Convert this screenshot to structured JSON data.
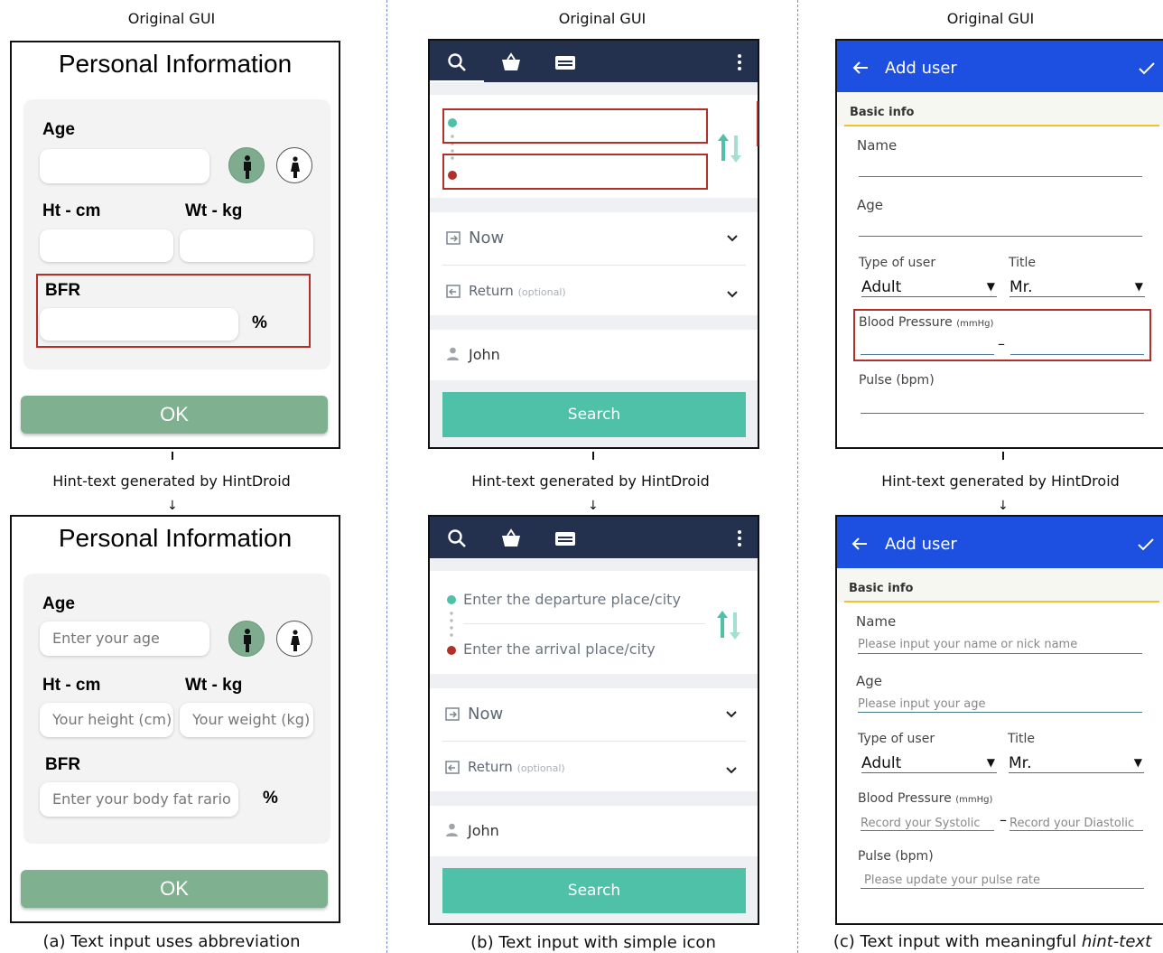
{
  "column_header": "Original GUI",
  "hint_label": "Hint-text generated by HintDroid",
  "captions": {
    "a": "(a) Text input uses abbreviation",
    "b": "(b) Text input with simple icon",
    "c_prefix": "(c) Text input with meaningful ",
    "c_italic": "hint-text"
  },
  "panel_a": {
    "title": "Personal Information",
    "age_label": "Age",
    "ht_label": "Ht - cm",
    "wt_label": "Wt - kg",
    "bfr_label": "BFR",
    "percent": "%",
    "ok": "OK",
    "hints": {
      "age": "Enter your age",
      "height": "Your height (cm)",
      "weight": "Your weight (kg)",
      "bfr": "Enter your body fat rario"
    }
  },
  "panel_b": {
    "date_label": "Now",
    "return_label": "Return",
    "return_optional": "(optional)",
    "passenger": "John",
    "search": "Search",
    "hints": {
      "departure": "Enter the departure place/city",
      "arrival": "Enter the arrival place/city"
    }
  },
  "panel_c": {
    "title": "Add user",
    "section": "Basic info",
    "name_label": "Name",
    "age_label": "Age",
    "type_label": "Type of user",
    "title_label": "Title",
    "type_value": "Adult",
    "title_value": "Mr.",
    "bp_label": "Blood Pressure",
    "bp_unit": "(mmHg)",
    "dash": "–",
    "pulse_label": "Pulse (bpm)",
    "hints": {
      "name": "Please input your name or nick name",
      "age": "Please input your age",
      "systolic": "Record your Systolic",
      "diastolic": "Record your Diastolic",
      "pulse": "Please update your pulse rate"
    }
  },
  "colors": {
    "highlight_red": "#b3302a",
    "green_button": "#7fb08f",
    "navy_bar": "#23314f",
    "teal": "#4fc1a8",
    "blue_bar": "#1d4fe0",
    "yellow_accent": "#f2c12e"
  }
}
